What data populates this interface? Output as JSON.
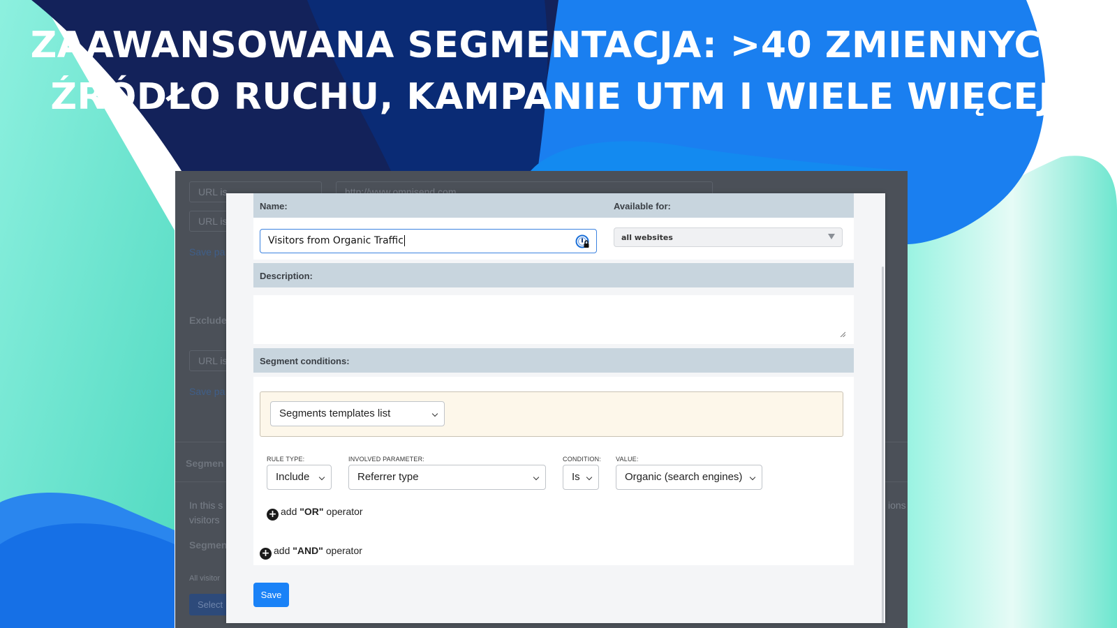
{
  "headline": {
    "line1": "ZAAWANSOWANA SEGMENTACJA: >40 ZMIENNYCH:",
    "line2": "ŹRÓDŁO RUCHU, KAMPANIE UTM I WIELE WIĘCEJ."
  },
  "colors": {
    "background_dark": "#0f1f4d",
    "background_blue": "#1a7ff0",
    "background_teal": "#5fe0c8",
    "section_header": "#c8d5de",
    "accent_button": "#1a82f7",
    "templates_box": "#fdf7ea"
  },
  "backdrop": {
    "field1": "URL is",
    "field1_value": "http://www.omnisend.com",
    "field2": "URL is",
    "save_link1": "Save pa",
    "exclude_label": "Exclude",
    "field3": "URL is",
    "save_link2": "Save pa",
    "segment_label": "Segmen",
    "info_text_1": "In this s",
    "info_text_2": "visitors",
    "info_text_right": "ions",
    "segment_label_2": "Segmen",
    "all_visitors": "All visitor",
    "select_button": "Select"
  },
  "modal": {
    "name_label": "Name:",
    "available_label": "Available for:",
    "name_value": "Visitors from Organic Traffic",
    "available_value": "all websites",
    "description_label": "Description:",
    "description_value": "",
    "conditions_label": "Segment conditions:",
    "templates_select": "Segments templates list",
    "rule_type_label": "RULE TYPE:",
    "rule_type_value": "Include",
    "parameter_label": "INVOLVED PARAMETER:",
    "parameter_value": "Referrer type",
    "condition_label": "CONDITION:",
    "condition_value": "Is",
    "value_label": "VALUE:",
    "value_value": "Organic (search engines)",
    "add_or_prefix": "add ",
    "add_or_bold": "\"OR\"",
    "add_or_suffix": " operator",
    "add_and_prefix": "add ",
    "add_and_bold": "\"AND\"",
    "add_and_suffix": " operator",
    "save_label": "Save",
    "icons": {
      "password_manager": "password-manager-icon",
      "dropdown": "triangle-down-icon",
      "chevron": "chevron-down-icon",
      "plus": "plus-circle-icon",
      "resize": "resize-handle-icon"
    }
  }
}
